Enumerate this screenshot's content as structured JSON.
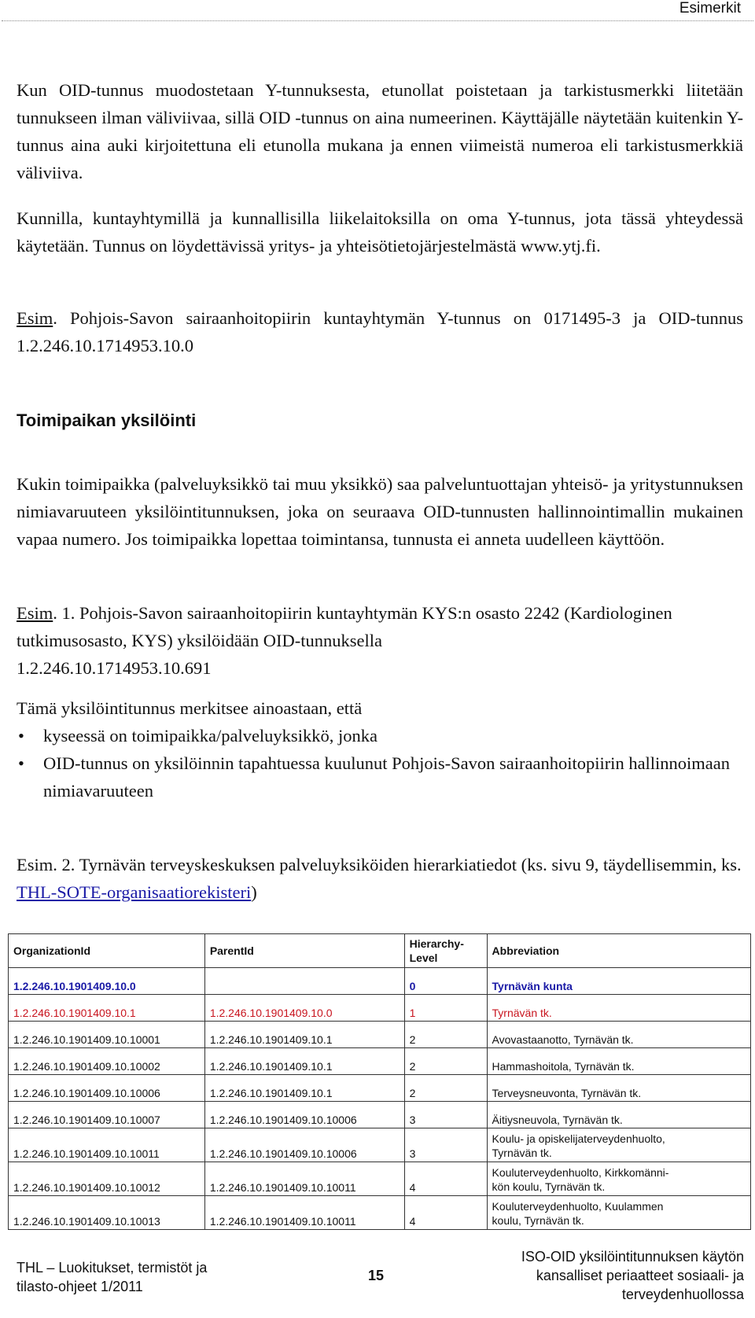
{
  "header": {
    "section_title": "Esimerkit"
  },
  "paragraphs": {
    "p1": "Kun OID-tunnus muodostetaan Y-tunnuksesta, etunollat poistetaan ja tarkistusmerkki liitetään tunnukseen ilman väliviivaa, sillä OID -tunnus on aina numeerinen. Käyttäjälle näytetään kuitenkin Y-tunnus aina auki kirjoitettuna eli etunolla mukana ja ennen viimeistä numeroa eli tarkistusmerkkiä väliviiva.",
    "p2": "Kunnilla, kuntayhtymillä ja kunnallisilla liikelaitoksilla on oma Y-tunnus, jota tässä yhteydessä käytetään. Tunnus on löydettävissä yritys- ja yhteisötietojärjestelmästä www.ytj.fi.",
    "p3_label": "Esim",
    "p3_text": ". Pohjois-Savon sairaanhoitopiirin kuntayhtymän Y-tunnus on 0171495-3 ja OID-tunnus 1.2.246.10.1714953.10.0",
    "heading": "Toimipaikan yksilöinti",
    "p4": "Kukin toimipaikka (palveluyksikkö tai muu yksikkö) saa palveluntuottajan yhteisö- ja yritystunnuksen nimiavaruuteen yksilöintitunnuksen, joka on seuraava OID-tunnusten hallinnointimallin mukainen vapaa numero. Jos toimipaikka lopettaa toimintansa, tunnusta ei anneta uudelleen käyttöön.",
    "p5_label": "Esim",
    "p5_text": ". 1. Pohjois-Savon sairaanhoitopiirin kuntayhtymän KYS:n osasto 2242 (Kardiologinen tutkimusosasto, KYS) yksilöidään OID-tunnuksella",
    "p5_oid": "1.2.246.10.1714953.10.691",
    "p6": "Tämä yksilöintitunnus merkitsee ainoastaan, että",
    "bullets": [
      "kyseessä on toimipaikka/palveluyksikkö, jonka",
      "OID-tunnus on yksilöinnin tapahtuessa kuulunut Pohjois-Savon sairaanhoitopiirin hallinnoimaan nimiavaruuteen"
    ],
    "p7_text": "Esim. 2. Tyrnävän terveyskeskuksen palveluyksiköiden hierarkiatiedot (ks. sivu 9, täydellisemmin, ks. ",
    "p7_link": "THL-SOTE-organisaatiorekisteri",
    "p7_end": ")"
  },
  "table": {
    "headers": [
      "OrganizationId",
      "ParentId",
      "Hierarchy-Level",
      "Abbreviation"
    ],
    "header_level_line1": "Hierarchy-",
    "header_level_line2": "Level",
    "rows": [
      {
        "org": "1.2.246.10.1901409.10.0",
        "parent": "",
        "level": "0",
        "abbr": "Tyrnävän kunta",
        "style": "blue"
      },
      {
        "org": "1.2.246.10.1901409.10.1",
        "parent": "1.2.246.10.1901409.10.0",
        "level": "1",
        "abbr": "Tyrnävän tk.",
        "style": "red"
      },
      {
        "org": "1.2.246.10.1901409.10.10001",
        "parent": "1.2.246.10.1901409.10.1",
        "level": "2",
        "abbr": "Avovastaanotto, Tyrnävän tk."
      },
      {
        "org": "1.2.246.10.1901409.10.10002",
        "parent": "1.2.246.10.1901409.10.1",
        "level": "2",
        "abbr": "Hammashoitola, Tyrnävän tk."
      },
      {
        "org": "1.2.246.10.1901409.10.10006",
        "parent": "1.2.246.10.1901409.10.1",
        "level": "2",
        "abbr": "Terveysneuvonta, Tyrnävän tk."
      },
      {
        "org": "1.2.246.10.1901409.10.10007",
        "parent": "1.2.246.10.1901409.10.10006",
        "level": "3",
        "abbr": "Äitiysneuvola, Tyrnävän tk."
      },
      {
        "org": "1.2.246.10.1901409.10.10011",
        "parent": "1.2.246.10.1901409.10.10006",
        "level": "3",
        "abbr_line1": "Koulu- ja opiskelijaterveydenhuolto,",
        "abbr_line2": "Tyrnävän tk."
      },
      {
        "org": "1.2.246.10.1901409.10.10012",
        "parent": "1.2.246.10.1901409.10.10011",
        "level": "4",
        "abbr_line1": "Kouluterveydenhuolto, Kirkkomänni-",
        "abbr_line2": "kön koulu, Tyrnävän tk."
      },
      {
        "org": "1.2.246.10.1901409.10.10013",
        "parent": "1.2.246.10.1901409.10.10011",
        "level": "4",
        "abbr_line1": "Kouluterveydenhuolto, Kuulammen",
        "abbr_line2": "koulu, Tyrnävän tk."
      }
    ]
  },
  "footer": {
    "left_line1": "THL  – Luokitukset, termistöt ja",
    "left_line2": "tilasto-ohjeet 1/2011",
    "page_number": "15",
    "right_line1": "ISO-OID yksilöintitunnuksen käytön",
    "right_line2": "kansalliset periaatteet sosiaali- ja",
    "right_line3": "terveydenhuollossa"
  },
  "colors": {
    "blue_row": "#1a1aa6",
    "red_row": "#c8141e",
    "link": "#1a1aa6"
  }
}
